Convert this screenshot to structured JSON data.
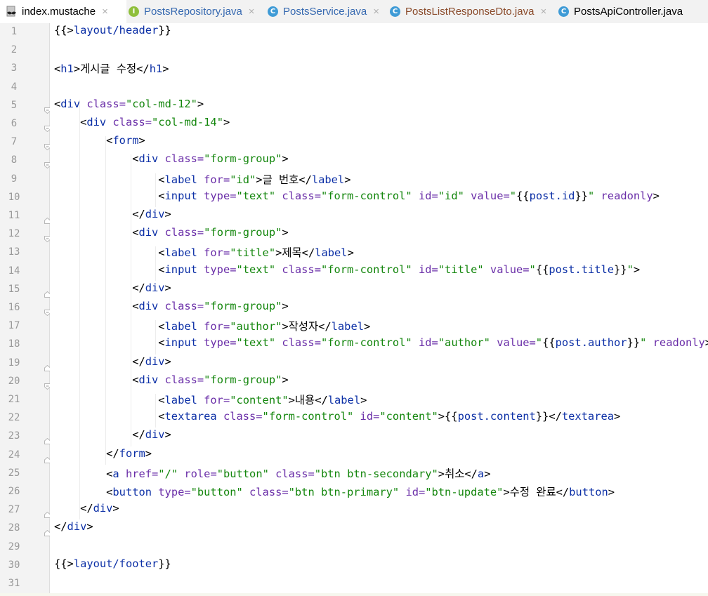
{
  "tabs": [
    {
      "label": "index.mustache",
      "icon": "mustache-file-icon",
      "color": "#000000",
      "active": true,
      "close": "×"
    },
    {
      "label": "PostsRepository.java",
      "icon": "interface-icon",
      "color": "#3568b0",
      "active": false,
      "close": "×"
    },
    {
      "label": "PostsService.java",
      "icon": "class-icon",
      "color": "#3568b0",
      "active": false,
      "close": "×"
    },
    {
      "label": "PostsListResponseDto.java",
      "icon": "class-icon",
      "color": "#8a4a2a",
      "active": false,
      "close": "×"
    },
    {
      "label": "PostsApiController.java",
      "icon": "class-icon",
      "color": "#000000",
      "active": false,
      "close": ""
    }
  ],
  "colors": {
    "tag": "#0b2fa6",
    "attr": "#6a2ea8",
    "value": "#13860c",
    "text": "#000000",
    "mustache": "#0b2fa6",
    "line_number": "#999999"
  },
  "lines": [
    {
      "number": "1",
      "segments": [
        {
          "t": "{{>",
          "c": "text"
        },
        {
          "t": "layout/header",
          "c": "tag"
        },
        {
          "t": "}}",
          "c": "text"
        }
      ]
    },
    {
      "number": "2",
      "segments": []
    },
    {
      "number": "3",
      "segments": [
        {
          "t": "<",
          "c": "text"
        },
        {
          "t": "h1",
          "c": "tag"
        },
        {
          "t": ">게시글 수정</",
          "c": "text"
        },
        {
          "t": "h1",
          "c": "tag"
        },
        {
          "t": ">",
          "c": "text"
        }
      ]
    },
    {
      "number": "4",
      "segments": []
    },
    {
      "number": "5",
      "segments": [
        {
          "t": "<",
          "c": "text"
        },
        {
          "t": "div ",
          "c": "tag"
        },
        {
          "t": "class=",
          "c": "attr"
        },
        {
          "t": "\"col-md-12\"",
          "c": "value"
        },
        {
          "t": ">",
          "c": "text"
        }
      ]
    },
    {
      "number": "6",
      "segments": [
        {
          "t": "    <",
          "c": "text"
        },
        {
          "t": "div ",
          "c": "tag"
        },
        {
          "t": "class=",
          "c": "attr"
        },
        {
          "t": "\"col-md-14\"",
          "c": "value"
        },
        {
          "t": ">",
          "c": "text"
        }
      ]
    },
    {
      "number": "7",
      "segments": [
        {
          "t": "        <",
          "c": "text"
        },
        {
          "t": "form",
          "c": "tag"
        },
        {
          "t": ">",
          "c": "text"
        }
      ]
    },
    {
      "number": "8",
      "segments": [
        {
          "t": "            <",
          "c": "text"
        },
        {
          "t": "div ",
          "c": "tag"
        },
        {
          "t": "class=",
          "c": "attr"
        },
        {
          "t": "\"form-group\"",
          "c": "value"
        },
        {
          "t": ">",
          "c": "text"
        }
      ]
    },
    {
      "number": "9",
      "segments": [
        {
          "t": "                <",
          "c": "text"
        },
        {
          "t": "label ",
          "c": "tag"
        },
        {
          "t": "for=",
          "c": "attr"
        },
        {
          "t": "\"id\"",
          "c": "value"
        },
        {
          "t": ">글 번호</",
          "c": "text"
        },
        {
          "t": "label",
          "c": "tag"
        },
        {
          "t": ">",
          "c": "text"
        }
      ]
    },
    {
      "number": "10",
      "segments": [
        {
          "t": "                <",
          "c": "text"
        },
        {
          "t": "input ",
          "c": "tag"
        },
        {
          "t": "type=",
          "c": "attr"
        },
        {
          "t": "\"text\" ",
          "c": "value"
        },
        {
          "t": "class=",
          "c": "attr"
        },
        {
          "t": "\"form-control\" ",
          "c": "value"
        },
        {
          "t": "id=",
          "c": "attr"
        },
        {
          "t": "\"id\" ",
          "c": "value"
        },
        {
          "t": "value=",
          "c": "attr"
        },
        {
          "t": "\"",
          "c": "value"
        },
        {
          "t": "{{",
          "c": "text"
        },
        {
          "t": "post.id",
          "c": "mustache"
        },
        {
          "t": "}}",
          "c": "text"
        },
        {
          "t": "\" ",
          "c": "value"
        },
        {
          "t": "readonly",
          "c": "attr"
        },
        {
          "t": ">",
          "c": "text"
        }
      ]
    },
    {
      "number": "11",
      "segments": [
        {
          "t": "            </",
          "c": "text"
        },
        {
          "t": "div",
          "c": "tag"
        },
        {
          "t": ">",
          "c": "text"
        }
      ]
    },
    {
      "number": "12",
      "segments": [
        {
          "t": "            <",
          "c": "text"
        },
        {
          "t": "div ",
          "c": "tag"
        },
        {
          "t": "class=",
          "c": "attr"
        },
        {
          "t": "\"form-group\"",
          "c": "value"
        },
        {
          "t": ">",
          "c": "text"
        }
      ]
    },
    {
      "number": "13",
      "segments": [
        {
          "t": "                <",
          "c": "text"
        },
        {
          "t": "label ",
          "c": "tag"
        },
        {
          "t": "for=",
          "c": "attr"
        },
        {
          "t": "\"title\"",
          "c": "value"
        },
        {
          "t": ">제목</",
          "c": "text"
        },
        {
          "t": "label",
          "c": "tag"
        },
        {
          "t": ">",
          "c": "text"
        }
      ]
    },
    {
      "number": "14",
      "segments": [
        {
          "t": "                <",
          "c": "text"
        },
        {
          "t": "input ",
          "c": "tag"
        },
        {
          "t": "type=",
          "c": "attr"
        },
        {
          "t": "\"text\" ",
          "c": "value"
        },
        {
          "t": "class=",
          "c": "attr"
        },
        {
          "t": "\"form-control\" ",
          "c": "value"
        },
        {
          "t": "id=",
          "c": "attr"
        },
        {
          "t": "\"title\" ",
          "c": "value"
        },
        {
          "t": "value=",
          "c": "attr"
        },
        {
          "t": "\"",
          "c": "value"
        },
        {
          "t": "{{",
          "c": "text"
        },
        {
          "t": "post.title",
          "c": "mustache"
        },
        {
          "t": "}}",
          "c": "text"
        },
        {
          "t": "\"",
          "c": "value"
        },
        {
          "t": ">",
          "c": "text"
        }
      ]
    },
    {
      "number": "15",
      "segments": [
        {
          "t": "            </",
          "c": "text"
        },
        {
          "t": "div",
          "c": "tag"
        },
        {
          "t": ">",
          "c": "text"
        }
      ]
    },
    {
      "number": "16",
      "segments": [
        {
          "t": "            <",
          "c": "text"
        },
        {
          "t": "div ",
          "c": "tag"
        },
        {
          "t": "class=",
          "c": "attr"
        },
        {
          "t": "\"form-group\"",
          "c": "value"
        },
        {
          "t": ">",
          "c": "text"
        }
      ]
    },
    {
      "number": "17",
      "segments": [
        {
          "t": "                <",
          "c": "text"
        },
        {
          "t": "label ",
          "c": "tag"
        },
        {
          "t": "for=",
          "c": "attr"
        },
        {
          "t": "\"author\"",
          "c": "value"
        },
        {
          "t": ">작성자</",
          "c": "text"
        },
        {
          "t": "label",
          "c": "tag"
        },
        {
          "t": ">",
          "c": "text"
        }
      ]
    },
    {
      "number": "18",
      "segments": [
        {
          "t": "                <",
          "c": "text"
        },
        {
          "t": "input ",
          "c": "tag"
        },
        {
          "t": "type=",
          "c": "attr"
        },
        {
          "t": "\"text\" ",
          "c": "value"
        },
        {
          "t": "class=",
          "c": "attr"
        },
        {
          "t": "\"form-control\" ",
          "c": "value"
        },
        {
          "t": "id=",
          "c": "attr"
        },
        {
          "t": "\"author\" ",
          "c": "value"
        },
        {
          "t": "value=",
          "c": "attr"
        },
        {
          "t": "\"",
          "c": "value"
        },
        {
          "t": "{{",
          "c": "text"
        },
        {
          "t": "post.author",
          "c": "mustache"
        },
        {
          "t": "}}",
          "c": "text"
        },
        {
          "t": "\" ",
          "c": "value"
        },
        {
          "t": "readonly",
          "c": "attr"
        },
        {
          "t": ">",
          "c": "text"
        }
      ]
    },
    {
      "number": "19",
      "segments": [
        {
          "t": "            </",
          "c": "text"
        },
        {
          "t": "div",
          "c": "tag"
        },
        {
          "t": ">",
          "c": "text"
        }
      ]
    },
    {
      "number": "20",
      "segments": [
        {
          "t": "            <",
          "c": "text"
        },
        {
          "t": "div ",
          "c": "tag"
        },
        {
          "t": "class=",
          "c": "attr"
        },
        {
          "t": "\"form-group\"",
          "c": "value"
        },
        {
          "t": ">",
          "c": "text"
        }
      ]
    },
    {
      "number": "21",
      "segments": [
        {
          "t": "                <",
          "c": "text"
        },
        {
          "t": "label ",
          "c": "tag"
        },
        {
          "t": "for=",
          "c": "attr"
        },
        {
          "t": "\"content\"",
          "c": "value"
        },
        {
          "t": ">내용</",
          "c": "text"
        },
        {
          "t": "label",
          "c": "tag"
        },
        {
          "t": ">",
          "c": "text"
        }
      ]
    },
    {
      "number": "22",
      "segments": [
        {
          "t": "                <",
          "c": "text"
        },
        {
          "t": "textarea ",
          "c": "tag"
        },
        {
          "t": "class=",
          "c": "attr"
        },
        {
          "t": "\"form-control\" ",
          "c": "value"
        },
        {
          "t": "id=",
          "c": "attr"
        },
        {
          "t": "\"content\"",
          "c": "value"
        },
        {
          "t": ">{{",
          "c": "text"
        },
        {
          "t": "post.content",
          "c": "mustache"
        },
        {
          "t": "}}</",
          "c": "text"
        },
        {
          "t": "textarea",
          "c": "tag"
        },
        {
          "t": ">",
          "c": "text"
        }
      ]
    },
    {
      "number": "23",
      "segments": [
        {
          "t": "            </",
          "c": "text"
        },
        {
          "t": "div",
          "c": "tag"
        },
        {
          "t": ">",
          "c": "text"
        }
      ]
    },
    {
      "number": "24",
      "segments": [
        {
          "t": "        </",
          "c": "text"
        },
        {
          "t": "form",
          "c": "tag"
        },
        {
          "t": ">",
          "c": "text"
        }
      ]
    },
    {
      "number": "25",
      "segments": [
        {
          "t": "        <",
          "c": "text"
        },
        {
          "t": "a ",
          "c": "tag"
        },
        {
          "t": "href=",
          "c": "attr"
        },
        {
          "t": "\"/\" ",
          "c": "value"
        },
        {
          "t": "role=",
          "c": "attr"
        },
        {
          "t": "\"button\" ",
          "c": "value"
        },
        {
          "t": "class=",
          "c": "attr"
        },
        {
          "t": "\"btn btn-secondary\"",
          "c": "value"
        },
        {
          "t": ">취소</",
          "c": "text"
        },
        {
          "t": "a",
          "c": "tag"
        },
        {
          "t": ">",
          "c": "text"
        }
      ]
    },
    {
      "number": "26",
      "segments": [
        {
          "t": "        <",
          "c": "text"
        },
        {
          "t": "button ",
          "c": "tag"
        },
        {
          "t": "type=",
          "c": "attr"
        },
        {
          "t": "\"button\" ",
          "c": "value"
        },
        {
          "t": "class=",
          "c": "attr"
        },
        {
          "t": "\"btn btn-primary\" ",
          "c": "value"
        },
        {
          "t": "id=",
          "c": "attr"
        },
        {
          "t": "\"btn-update\"",
          "c": "value"
        },
        {
          "t": ">수정 완료</",
          "c": "text"
        },
        {
          "t": "button",
          "c": "tag"
        },
        {
          "t": ">",
          "c": "text"
        }
      ]
    },
    {
      "number": "27",
      "segments": [
        {
          "t": "    </",
          "c": "text"
        },
        {
          "t": "div",
          "c": "tag"
        },
        {
          "t": ">",
          "c": "text"
        }
      ]
    },
    {
      "number": "28",
      "segments": [
        {
          "t": "</",
          "c": "text"
        },
        {
          "t": "div",
          "c": "tag"
        },
        {
          "t": ">",
          "c": "text"
        }
      ]
    },
    {
      "number": "29",
      "segments": []
    },
    {
      "number": "30",
      "segments": [
        {
          "t": "{{>",
          "c": "text"
        },
        {
          "t": "layout/footer",
          "c": "tag"
        },
        {
          "t": "}}",
          "c": "text"
        }
      ]
    },
    {
      "number": "31",
      "segments": []
    }
  ]
}
